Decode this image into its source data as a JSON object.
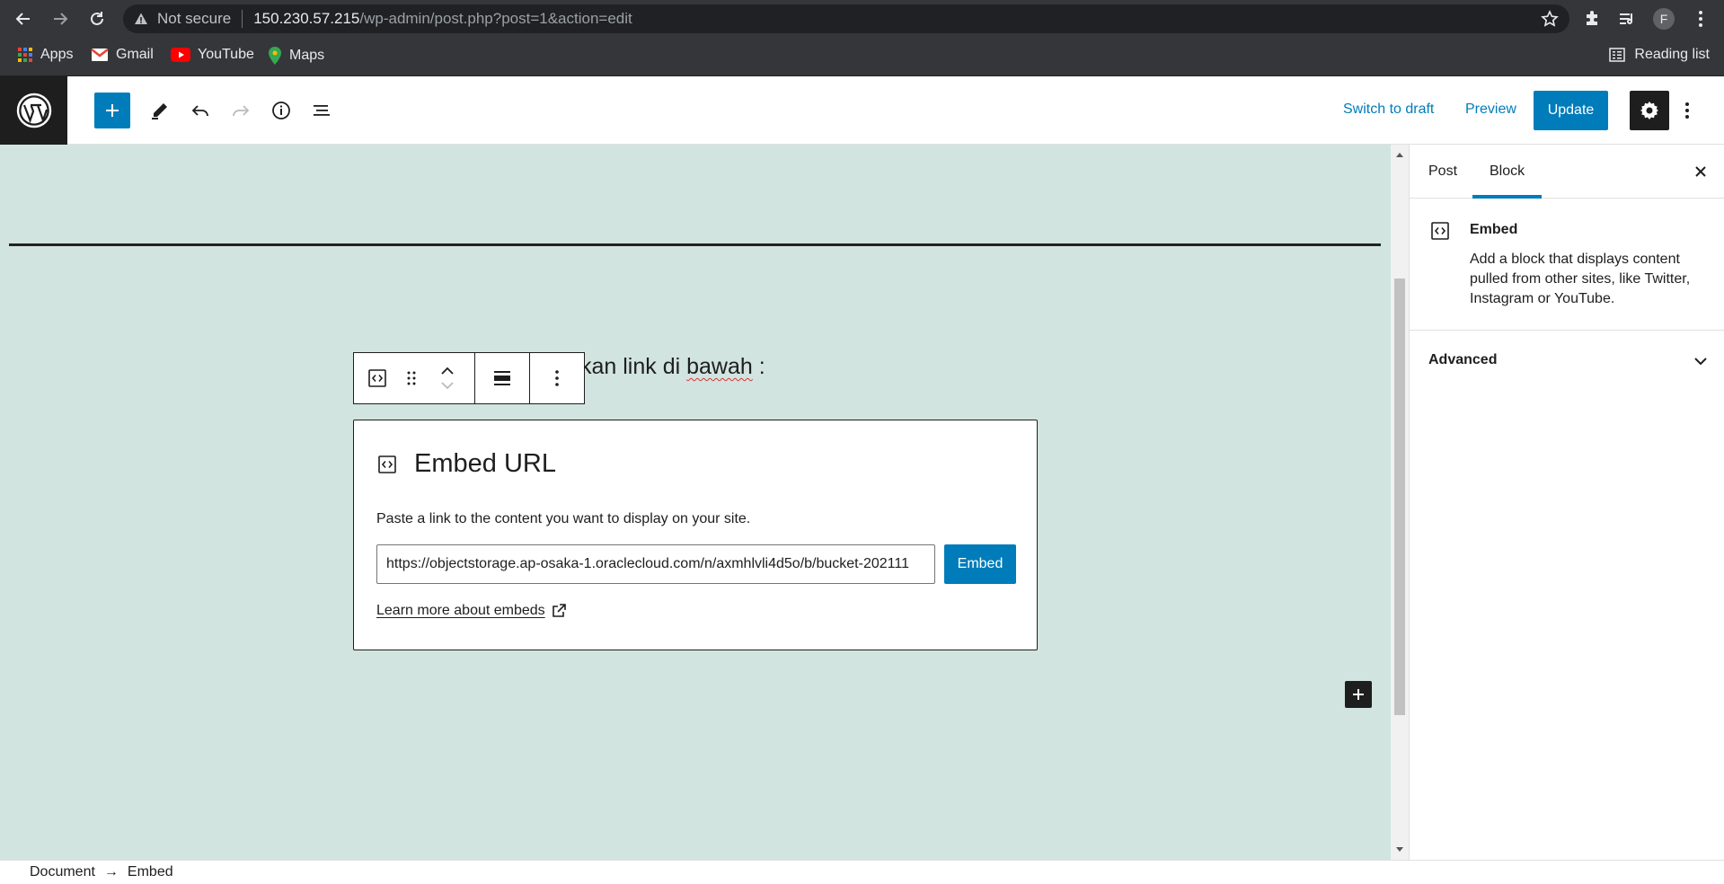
{
  "browser": {
    "security_label": "Not secure",
    "url_host": "150.230.57.215",
    "url_path": "/wp-admin/post.php?post=1&action=edit",
    "profile_initial": "F",
    "bookmarks": [
      {
        "label": "Apps",
        "icon": "apps-grid-icon"
      },
      {
        "label": "Gmail",
        "icon": "gmail-icon"
      },
      {
        "label": "YouTube",
        "icon": "youtube-icon"
      },
      {
        "label": "Maps",
        "icon": "maps-icon"
      }
    ],
    "reading_list": "Reading list"
  },
  "header": {
    "switch_to_draft": "Switch to draft",
    "preview": "Preview",
    "update": "Update"
  },
  "canvas": {
    "paragraph_prefix": "kan link di ",
    "paragraph_word": "bawah",
    "paragraph_suffix": " :",
    "embed": {
      "title": "Embed URL",
      "description": "Paste a link to the content you want to display on your site.",
      "input_value": "https://objectstorage.ap-osaka-1.oraclecloud.com/n/axmhlvli4d5o/b/bucket-202111",
      "submit_label": "Embed",
      "learn_more": "Learn more about embeds"
    }
  },
  "sidebar": {
    "tabs": [
      {
        "label": "Post",
        "active": false
      },
      {
        "label": "Block",
        "active": true
      }
    ],
    "block_card": {
      "title": "Embed",
      "description": "Add a block that displays content pulled from other sites, like Twitter, Instagram or YouTube."
    },
    "advanced_label": "Advanced"
  },
  "breadcrumb": {
    "root": "Document",
    "arrow": "→",
    "current": "Embed"
  },
  "colors": {
    "accent": "#007cba",
    "canvas_bg": "#d2e4df",
    "dark": "#1e1e1e",
    "chrome_bg": "#35363a"
  }
}
